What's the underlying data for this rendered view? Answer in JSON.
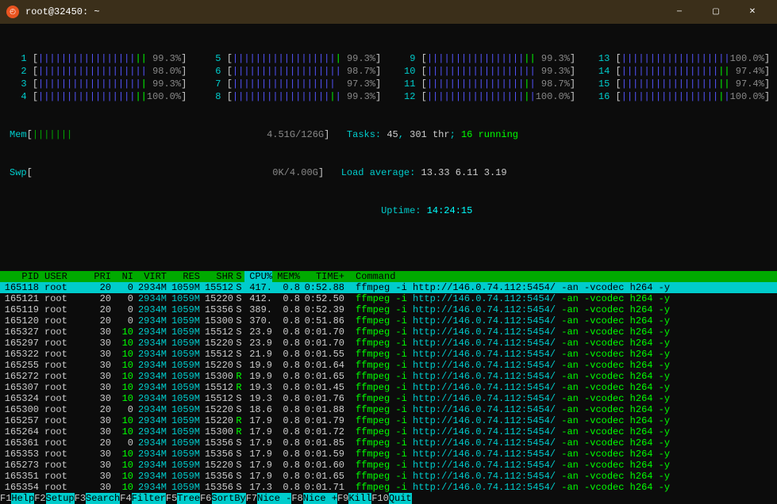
{
  "window": {
    "title": "root@32450: ~"
  },
  "meters": {
    "cpus": [
      {
        "id": "1",
        "pct": "99.3%"
      },
      {
        "id": "5",
        "pct": "99.3%"
      },
      {
        "id": "9",
        "pct": "99.3%"
      },
      {
        "id": "13",
        "pct": "100.0%"
      },
      {
        "id": "2",
        "pct": "98.0%"
      },
      {
        "id": "6",
        "pct": "98.7%"
      },
      {
        "id": "10",
        "pct": "99.3%"
      },
      {
        "id": "14",
        "pct": "97.4%"
      },
      {
        "id": "3",
        "pct": "99.3%"
      },
      {
        "id": "7",
        "pct": "97.3%"
      },
      {
        "id": "11",
        "pct": "98.7%"
      },
      {
        "id": "15",
        "pct": "97.4%"
      },
      {
        "id": "4",
        "pct": "100.0%"
      },
      {
        "id": "8",
        "pct": "99.3%"
      },
      {
        "id": "12",
        "pct": "100.0%"
      },
      {
        "id": "16",
        "pct": "100.0%"
      }
    ],
    "mem": {
      "label": "Mem",
      "used": "4.51G",
      "total": "126G"
    },
    "swp": {
      "label": "Swp",
      "used": "0K",
      "total": "4.00G"
    },
    "tasks": {
      "label": "Tasks:",
      "total": "45",
      "thr": "301 thr",
      "running": "16 running"
    },
    "load": {
      "label": "Load average:",
      "v1": "13.33",
      "v2": "6.11",
      "v3": "3.19"
    },
    "uptime": {
      "label": "Uptime:",
      "val": "14:24:15"
    }
  },
  "headers": [
    "PID",
    "USER",
    "PRI",
    "NI",
    "VIRT",
    "RES",
    "SHR",
    "S",
    "CPU%",
    "MEM%",
    "TIME+",
    "Command"
  ],
  "processes": [
    {
      "pid": "165118",
      "user": "root",
      "pri": "20",
      "ni": "0",
      "virt": "2934M",
      "res": "1059M",
      "shr": "15512",
      "s": "S",
      "cpu": "417.",
      "mem": "0.8",
      "time": "0:52.88",
      "cmd": "ffmpeg -i http://146.0.74.112:5454/ -an -vcodec h264 -y",
      "sel": true
    },
    {
      "pid": "165121",
      "user": "root",
      "pri": "20",
      "ni": "0",
      "virt": "2934M",
      "res": "1059M",
      "shr": "15220",
      "s": "S",
      "cpu": "412.",
      "mem": "0.8",
      "time": "0:52.50",
      "cmd": "ffmpeg -i http://146.0.74.112:5454/ -an -vcodec h264 -y"
    },
    {
      "pid": "165119",
      "user": "root",
      "pri": "20",
      "ni": "0",
      "virt": "2934M",
      "res": "1059M",
      "shr": "15356",
      "s": "S",
      "cpu": "389.",
      "mem": "0.8",
      "time": "0:52.39",
      "cmd": "ffmpeg -i http://146.0.74.112:5454/ -an -vcodec h264 -y"
    },
    {
      "pid": "165120",
      "user": "root",
      "pri": "20",
      "ni": "0",
      "virt": "2934M",
      "res": "1059M",
      "shr": "15300",
      "s": "S",
      "cpu": "370.",
      "mem": "0.8",
      "time": "0:51.86",
      "cmd": "ffmpeg -i http://146.0.74.112:5454/ -an -vcodec h264 -y"
    },
    {
      "pid": "165327",
      "user": "root",
      "pri": "30",
      "ni": "10",
      "virt": "2934M",
      "res": "1059M",
      "shr": "15512",
      "s": "S",
      "cpu": "23.9",
      "mem": "0.8",
      "time": "0:01.70",
      "cmd": "ffmpeg -i http://146.0.74.112:5454/ -an -vcodec h264 -y",
      "ni_green": true
    },
    {
      "pid": "165297",
      "user": "root",
      "pri": "30",
      "ni": "10",
      "virt": "2934M",
      "res": "1059M",
      "shr": "15220",
      "s": "S",
      "cpu": "23.9",
      "mem": "0.8",
      "time": "0:01.70",
      "cmd": "ffmpeg -i http://146.0.74.112:5454/ -an -vcodec h264 -y",
      "ni_green": true
    },
    {
      "pid": "165322",
      "user": "root",
      "pri": "30",
      "ni": "10",
      "virt": "2934M",
      "res": "1059M",
      "shr": "15512",
      "s": "S",
      "cpu": "21.9",
      "mem": "0.8",
      "time": "0:01.55",
      "cmd": "ffmpeg -i http://146.0.74.112:5454/ -an -vcodec h264 -y",
      "ni_green": true
    },
    {
      "pid": "165255",
      "user": "root",
      "pri": "30",
      "ni": "10",
      "virt": "2934M",
      "res": "1059M",
      "shr": "15220",
      "s": "S",
      "cpu": "19.9",
      "mem": "0.8",
      "time": "0:01.64",
      "cmd": "ffmpeg -i http://146.0.74.112:5454/ -an -vcodec h264 -y",
      "ni_green": true
    },
    {
      "pid": "165272",
      "user": "root",
      "pri": "30",
      "ni": "10",
      "virt": "2934M",
      "res": "1059M",
      "shr": "15300",
      "s": "R",
      "cpu": "19.9",
      "mem": "0.8",
      "time": "0:01.65",
      "cmd": "ffmpeg -i http://146.0.74.112:5454/ -an -vcodec h264 -y",
      "ni_green": true,
      "running": true
    },
    {
      "pid": "165307",
      "user": "root",
      "pri": "30",
      "ni": "10",
      "virt": "2934M",
      "res": "1059M",
      "shr": "15512",
      "s": "R",
      "cpu": "19.3",
      "mem": "0.8",
      "time": "0:01.45",
      "cmd": "ffmpeg -i http://146.0.74.112:5454/ -an -vcodec h264 -y",
      "ni_green": true,
      "running": true
    },
    {
      "pid": "165324",
      "user": "root",
      "pri": "30",
      "ni": "10",
      "virt": "2934M",
      "res": "1059M",
      "shr": "15512",
      "s": "S",
      "cpu": "19.3",
      "mem": "0.8",
      "time": "0:01.76",
      "cmd": "ffmpeg -i http://146.0.74.112:5454/ -an -vcodec h264 -y",
      "ni_green": true
    },
    {
      "pid": "165300",
      "user": "root",
      "pri": "20",
      "ni": "0",
      "virt": "2934M",
      "res": "1059M",
      "shr": "15220",
      "s": "S",
      "cpu": "18.6",
      "mem": "0.8",
      "time": "0:01.88",
      "cmd": "ffmpeg -i http://146.0.74.112:5454/ -an -vcodec h264 -y"
    },
    {
      "pid": "165257",
      "user": "root",
      "pri": "30",
      "ni": "10",
      "virt": "2934M",
      "res": "1059M",
      "shr": "15220",
      "s": "R",
      "cpu": "17.9",
      "mem": "0.8",
      "time": "0:01.79",
      "cmd": "ffmpeg -i http://146.0.74.112:5454/ -an -vcodec h264 -y",
      "ni_green": true,
      "running": true
    },
    {
      "pid": "165264",
      "user": "root",
      "pri": "30",
      "ni": "10",
      "virt": "2934M",
      "res": "1059M",
      "shr": "15300",
      "s": "R",
      "cpu": "17.9",
      "mem": "0.8",
      "time": "0:01.72",
      "cmd": "ffmpeg -i http://146.0.74.112:5454/ -an -vcodec h264 -y",
      "ni_green": true,
      "running": true
    },
    {
      "pid": "165361",
      "user": "root",
      "pri": "20",
      "ni": "0",
      "virt": "2934M",
      "res": "1059M",
      "shr": "15356",
      "s": "S",
      "cpu": "17.9",
      "mem": "0.8",
      "time": "0:01.85",
      "cmd": "ffmpeg -i http://146.0.74.112:5454/ -an -vcodec h264 -y"
    },
    {
      "pid": "165353",
      "user": "root",
      "pri": "30",
      "ni": "10",
      "virt": "2934M",
      "res": "1059M",
      "shr": "15356",
      "s": "S",
      "cpu": "17.9",
      "mem": "0.8",
      "time": "0:01.59",
      "cmd": "ffmpeg -i http://146.0.74.112:5454/ -an -vcodec h264 -y",
      "ni_green": true
    },
    {
      "pid": "165273",
      "user": "root",
      "pri": "30",
      "ni": "10",
      "virt": "2934M",
      "res": "1059M",
      "shr": "15220",
      "s": "S",
      "cpu": "17.9",
      "mem": "0.8",
      "time": "0:01.60",
      "cmd": "ffmpeg -i http://146.0.74.112:5454/ -an -vcodec h264 -y",
      "ni_green": true
    },
    {
      "pid": "165351",
      "user": "root",
      "pri": "30",
      "ni": "10",
      "virt": "2934M",
      "res": "1059M",
      "shr": "15356",
      "s": "S",
      "cpu": "17.9",
      "mem": "0.8",
      "time": "0:01.65",
      "cmd": "ffmpeg -i http://146.0.74.112:5454/ -an -vcodec h264 -y",
      "ni_green": true
    },
    {
      "pid": "165354",
      "user": "root",
      "pri": "30",
      "ni": "10",
      "virt": "2934M",
      "res": "1059M",
      "shr": "15356",
      "s": "S",
      "cpu": "17.3",
      "mem": "0.8",
      "time": "0:01.71",
      "cmd": "ffmpeg -i http://146.0.74.112:5454/ -an -vcodec h264 -y",
      "ni_green": true
    }
  ],
  "footer": [
    {
      "key": "F1",
      "label": "Help  "
    },
    {
      "key": "F2",
      "label": "Setup "
    },
    {
      "key": "F3",
      "label": "Search"
    },
    {
      "key": "F4",
      "label": "Filter"
    },
    {
      "key": "F5",
      "label": "Tree  "
    },
    {
      "key": "F6",
      "label": "SortBy"
    },
    {
      "key": "F7",
      "label": "Nice -"
    },
    {
      "key": "F8",
      "label": "Nice +"
    },
    {
      "key": "F9",
      "label": "Kill  "
    },
    {
      "key": "F10",
      "label": "Quit  "
    }
  ]
}
